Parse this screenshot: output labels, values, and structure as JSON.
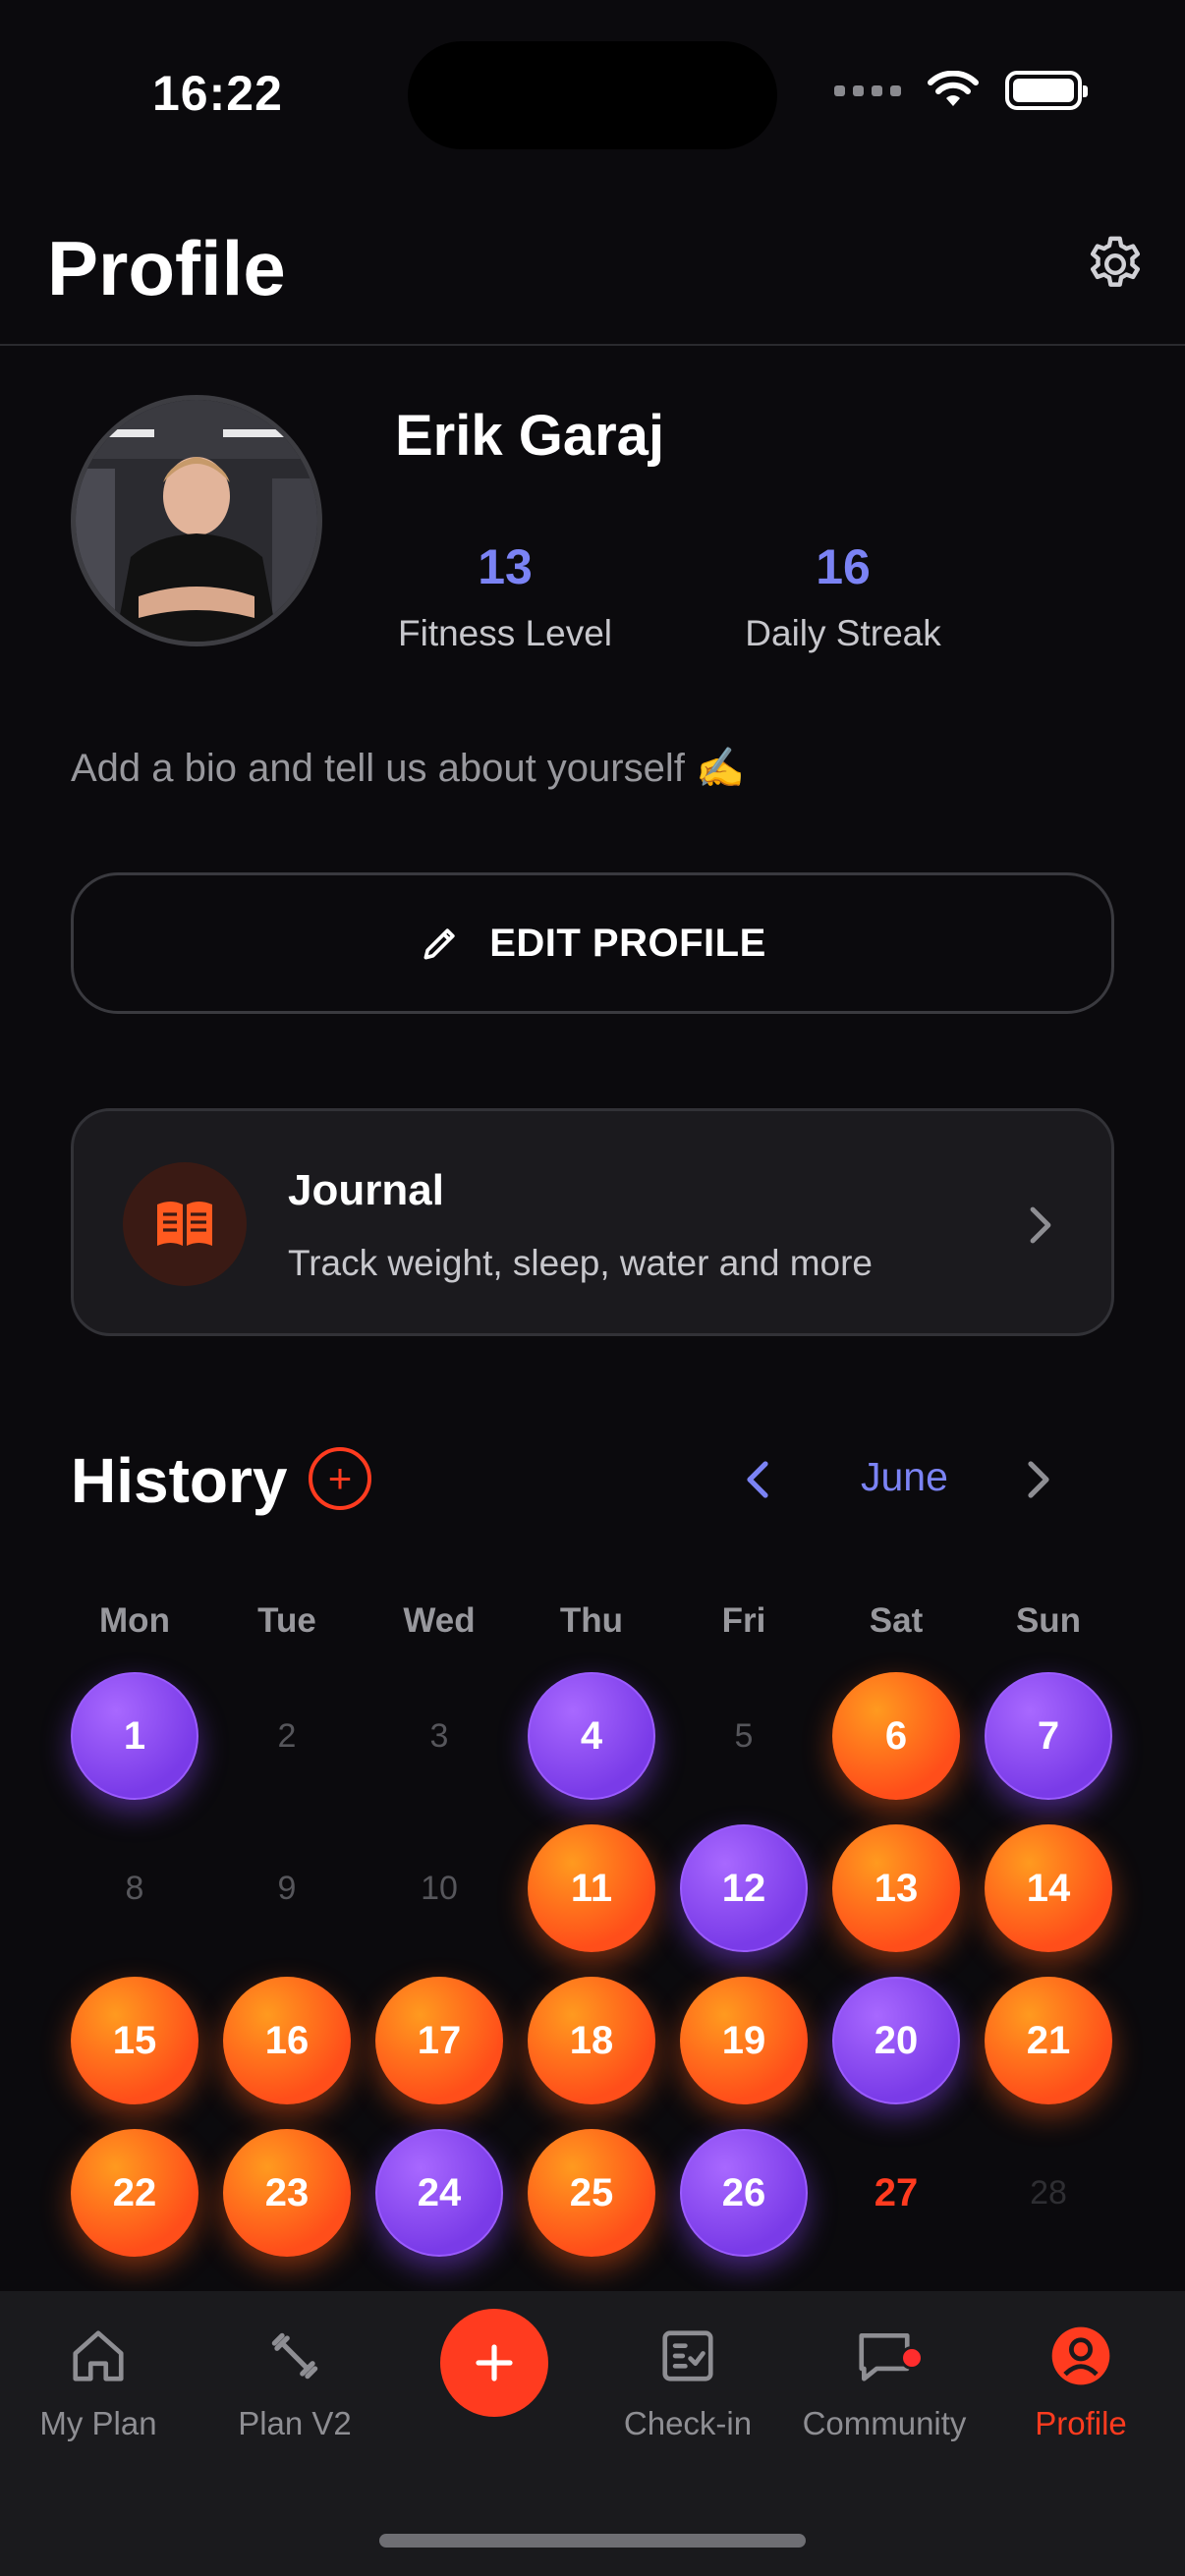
{
  "status_bar": {
    "time": "16:22"
  },
  "header": {
    "title": "Profile"
  },
  "profile": {
    "name": "Erik Garaj",
    "stats": [
      {
        "value": "13",
        "label": "Fitness Level"
      },
      {
        "value": "16",
        "label": "Daily Streak"
      }
    ],
    "bio_placeholder": "Add a bio and tell us about yourself ✍️",
    "edit_button": "EDIT PROFILE"
  },
  "journal": {
    "title": "Journal",
    "subtitle": "Track weight, sleep, water and more"
  },
  "history": {
    "title": "History",
    "month": "June",
    "weekdays": [
      "Mon",
      "Tue",
      "Wed",
      "Thu",
      "Fri",
      "Sat",
      "Sun"
    ],
    "days": [
      {
        "label": "1",
        "status": "purple"
      },
      {
        "label": "2",
        "status": "empty"
      },
      {
        "label": "3",
        "status": "empty"
      },
      {
        "label": "4",
        "status": "purple"
      },
      {
        "label": "5",
        "status": "empty"
      },
      {
        "label": "6",
        "status": "orange"
      },
      {
        "label": "7",
        "status": "purple"
      },
      {
        "label": "8",
        "status": "empty"
      },
      {
        "label": "9",
        "status": "empty"
      },
      {
        "label": "10",
        "status": "empty"
      },
      {
        "label": "11",
        "status": "orange"
      },
      {
        "label": "12",
        "status": "purple"
      },
      {
        "label": "13",
        "status": "orange"
      },
      {
        "label": "14",
        "status": "orange"
      },
      {
        "label": "15",
        "status": "orange"
      },
      {
        "label": "16",
        "status": "orange"
      },
      {
        "label": "17",
        "status": "orange"
      },
      {
        "label": "18",
        "status": "orange"
      },
      {
        "label": "19",
        "status": "orange"
      },
      {
        "label": "20",
        "status": "purple"
      },
      {
        "label": "21",
        "status": "orange"
      },
      {
        "label": "22",
        "status": "orange"
      },
      {
        "label": "23",
        "status": "orange"
      },
      {
        "label": "24",
        "status": "purple"
      },
      {
        "label": "25",
        "status": "orange"
      },
      {
        "label": "26",
        "status": "purple"
      },
      {
        "label": "27",
        "status": "today"
      },
      {
        "label": "28",
        "status": "future"
      }
    ]
  },
  "tabbar": {
    "items": [
      {
        "label": "My Plan",
        "icon": "home-icon"
      },
      {
        "label": "Plan V2",
        "icon": "dumbbell-icon"
      },
      {
        "label": "",
        "icon": "plus-icon"
      },
      {
        "label": "Check-in",
        "icon": "checklist-icon"
      },
      {
        "label": "Community",
        "icon": "chat-icon"
      },
      {
        "label": "Profile",
        "icon": "profile-icon"
      }
    ],
    "active": "Profile"
  },
  "colors": {
    "accent": "#ff3b1f",
    "stat_blue": "#7b83f4",
    "purple_day": "#8a4cf0",
    "orange_day": "#ff6a1a",
    "background": "#0b0a0d"
  }
}
